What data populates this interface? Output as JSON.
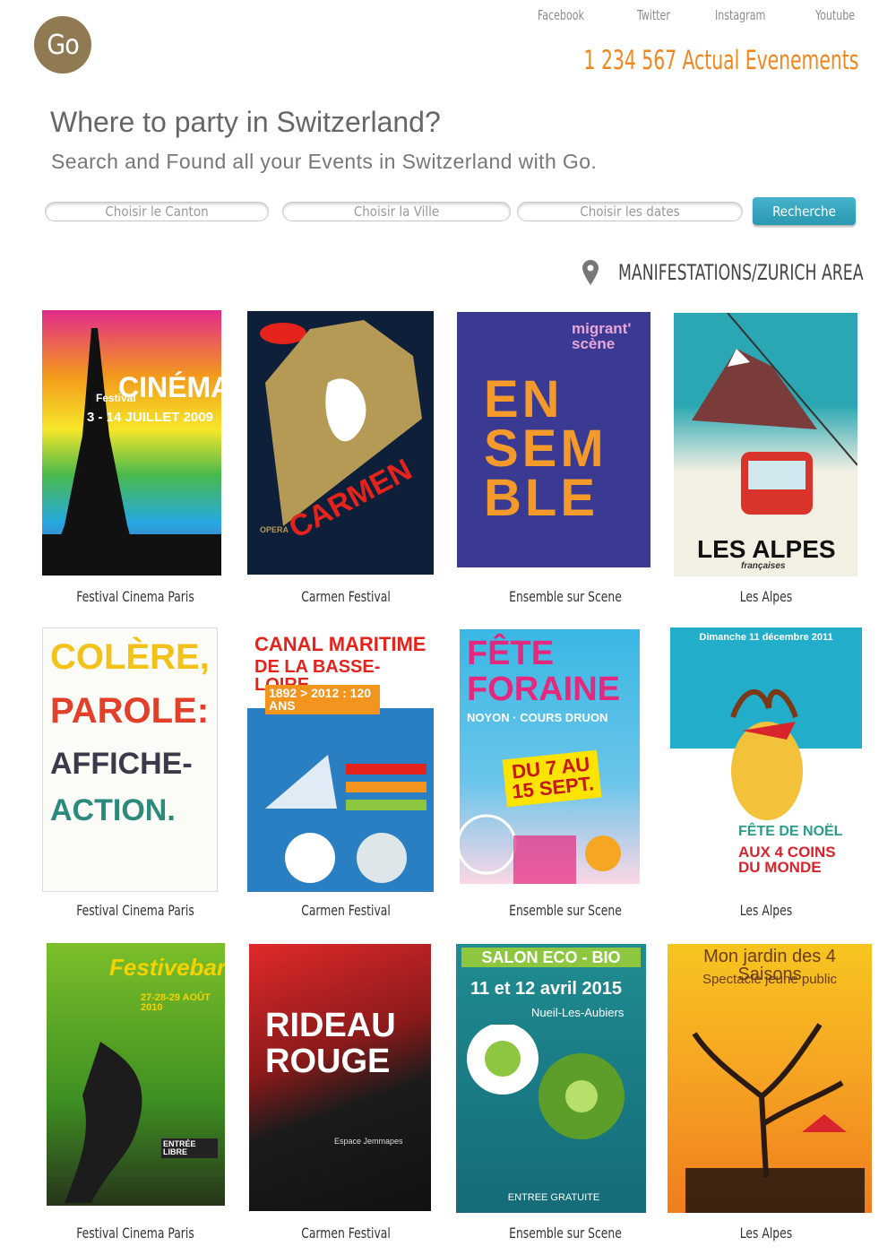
{
  "brand": {
    "logo_text": "Go"
  },
  "social": [
    {
      "label": "Facebook"
    },
    {
      "label": "Twitter"
    },
    {
      "label": "Instagram"
    },
    {
      "label": "Youtube"
    }
  ],
  "header": {
    "events_count": "1 234 567 Actual Evenements"
  },
  "hero": {
    "title": "Where to party in Switzerland?",
    "subtitle": "Search and Found all your Events in Switzerland with Go."
  },
  "search": {
    "canton_placeholder": "Choisir le Canton",
    "ville_placeholder": "Choisir la Ville",
    "dates_placeholder": "Choisir les dates",
    "button_label": "Recherche"
  },
  "section": {
    "title": "MANIFESTATIONS/ZURICH AREA",
    "icon": "map-pin-icon"
  },
  "events": [
    {
      "caption": "Festival Cinema Paris",
      "poster_lines": [
        "Festival",
        "CINÉMA",
        "3 - 14 JUILLET 2009"
      ]
    },
    {
      "caption": "Carmen Festival",
      "poster_lines": [
        "CARMEN",
        "OPERA"
      ]
    },
    {
      "caption": "Ensemble sur Scene",
      "poster_lines": [
        "migrant' scène",
        "EN SEM BLE"
      ]
    },
    {
      "caption": "Les Alpes",
      "poster_lines": [
        "LES ALPES",
        "françaises"
      ]
    },
    {
      "caption": "Festival Cinema Paris",
      "poster_lines": [
        "COLÈRE,",
        "PAROLE:",
        "AFFICHE-",
        "ACTION."
      ]
    },
    {
      "caption": "Carmen Festival",
      "poster_lines": [
        "CANAL MARITIME",
        "DE LA BASSE-LOIRE",
        "1892 > 2012 : 120 ANS"
      ]
    },
    {
      "caption": "Ensemble sur Scene",
      "poster_lines": [
        "FÊTE",
        "FORAINE",
        "NOYON · COURS DRUON",
        "DU 7 AU 15 SEPT."
      ]
    },
    {
      "caption": "Les Alpes",
      "poster_lines": [
        "Dimanche 11 décembre 2011",
        "FÊTE DE NOËL",
        "AUX 4 COINS DU MONDE"
      ]
    },
    {
      "caption": "Festival Cinema Paris",
      "poster_lines": [
        "Festivebant",
        "27-28-29 AOÛT 2010",
        "ENTRÉE LIBRE"
      ]
    },
    {
      "caption": "Carmen Festival",
      "poster_lines": [
        "RIDEAU",
        "ROUGE",
        "Espace Jemmapes"
      ]
    },
    {
      "caption": "Ensemble sur Scene",
      "poster_lines": [
        "SALON ECO - BIO",
        "11 et 12 avril 2015",
        "Nueil-Les-Aubiers",
        "ENTREE GRATUITE"
      ]
    },
    {
      "caption": "Les Alpes",
      "poster_lines": [
        "Mon jardin des 4 Saisons",
        "Spectacle jeune public"
      ]
    }
  ],
  "colors": {
    "accent_orange": "#f0861e",
    "logo_brown": "#8f7a52",
    "button_blue": "#2fa0b9"
  }
}
